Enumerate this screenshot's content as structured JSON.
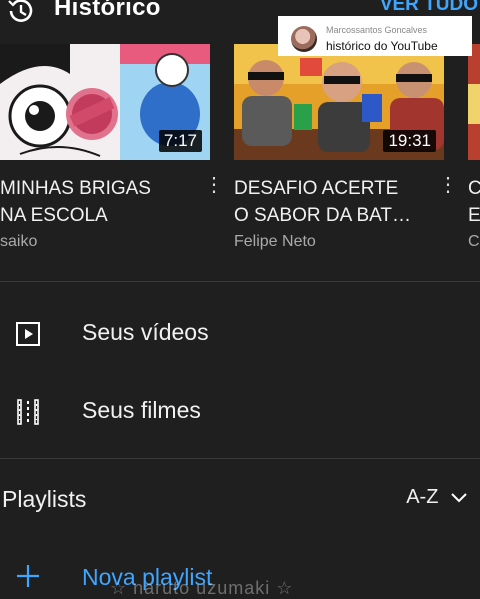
{
  "header": {
    "title": "Histórico",
    "see_all": "VER TUDO",
    "icon": "history-icon"
  },
  "overlay_comment": {
    "user": "Marcossantos Goncalves",
    "text": "histórico do YouTube"
  },
  "history": [
    {
      "title_line1": "MINHAS BRIGAS",
      "title_line2": "NA ESCOLA",
      "channel": "saiko",
      "duration": "7:17"
    },
    {
      "title_line1": "DESAFIO ACERTE",
      "title_line2": "O SABOR DA BAT…",
      "channel": "Felipe Neto",
      "duration": "19:31"
    },
    {
      "title_line1": "C",
      "title_line2": "E",
      "channel": "C"
    }
  ],
  "library": [
    {
      "label": "Seus vídeos",
      "icon": "play-box-icon"
    },
    {
      "label": "Seus filmes",
      "icon": "film-strip-icon"
    }
  ],
  "playlists": {
    "heading": "Playlists",
    "sort_label": "A-Z",
    "new_playlist": "Nova playlist"
  },
  "watermark": "☆ naruto uzumaki ☆",
  "colors": {
    "background": "#1f1f1f",
    "accent": "#3ea6ff",
    "secondary_text": "#aaaaaa"
  }
}
